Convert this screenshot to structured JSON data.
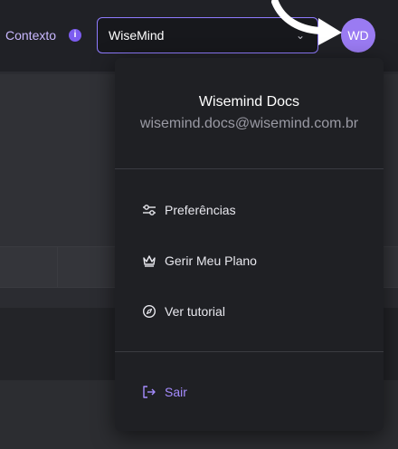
{
  "header": {
    "context_label": "Contexto",
    "context_info_icon": "info-icon",
    "context_select": {
      "value": "WiseMind",
      "icon": "chevron-down-icon"
    },
    "avatar_initials": "WD"
  },
  "user_menu": {
    "name": "Wisemind Docs",
    "email": "wisemind.docs@wisemind.com.br",
    "items": [
      {
        "label": "Preferências",
        "icon": "sliders-icon"
      },
      {
        "label": "Gerir Meu Plano",
        "icon": "crown-icon"
      },
      {
        "label": "Ver tutorial",
        "icon": "compass-icon"
      }
    ],
    "logout": {
      "label": "Sair",
      "icon": "logout-icon"
    }
  },
  "colors": {
    "accent": "#9a7bf2",
    "select_border": "#8f7bff",
    "logout": "#a58cff"
  }
}
